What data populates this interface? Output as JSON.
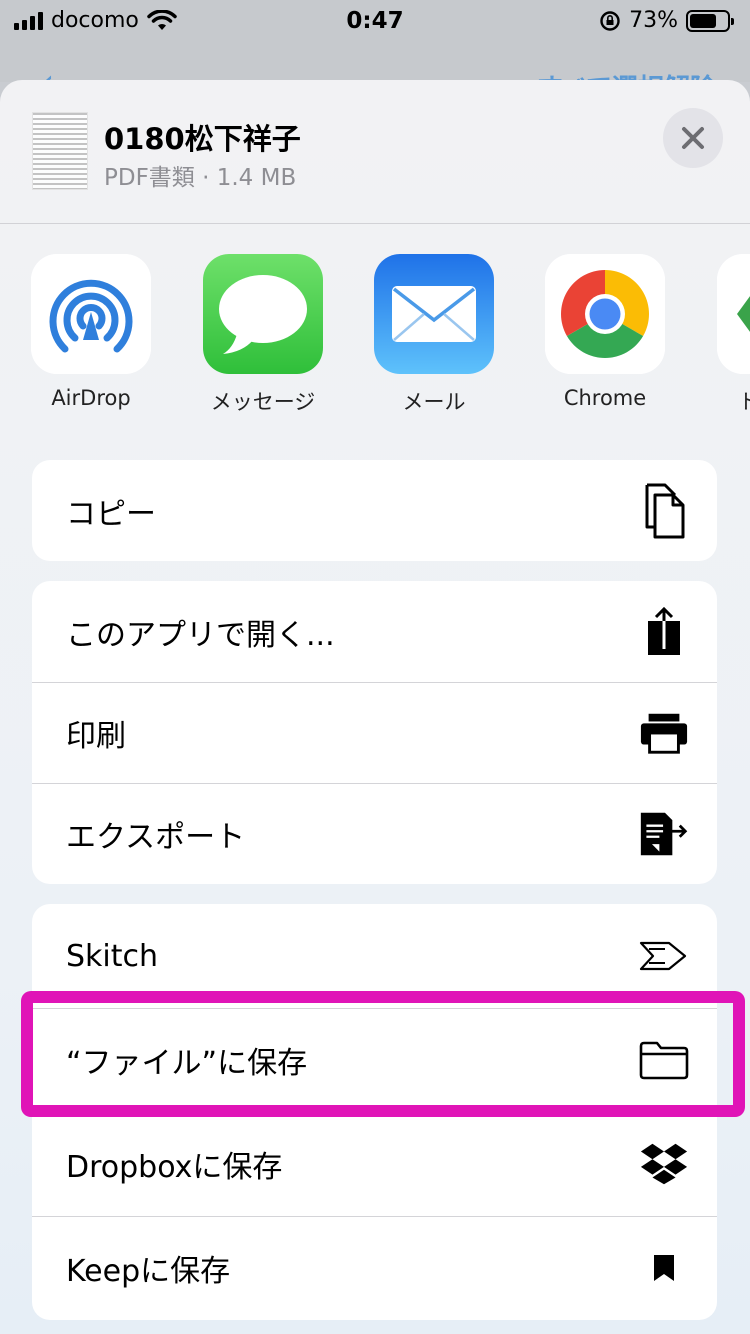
{
  "status_bar": {
    "carrier": "docomo",
    "time": "0:47",
    "battery": "73%",
    "battery_level": 0.73
  },
  "background": {
    "right_text": "すべて選択解除"
  },
  "share_sheet": {
    "doc_title": "0180松下祥子",
    "doc_subtitle": "PDF書類 · 1.4 MB",
    "apps": [
      {
        "label": "AirDrop",
        "icon": "airdrop-icon"
      },
      {
        "label": "メッセージ",
        "icon": "messages-icon"
      },
      {
        "label": "メール",
        "icon": "mail-icon"
      },
      {
        "label": "Chrome",
        "icon": "chrome-icon"
      },
      {
        "label": "ト",
        "icon": "partial-app-icon"
      }
    ],
    "groups": [
      [
        {
          "label": "コピー",
          "icon": "copy-icon"
        }
      ],
      [
        {
          "label": "このアプリで開く...",
          "icon": "share-icon"
        },
        {
          "label": "印刷",
          "icon": "print-icon"
        },
        {
          "label": "エクスポート",
          "icon": "export-icon"
        }
      ],
      [
        {
          "label": "Skitch",
          "icon": "skitch-icon"
        },
        {
          "label": "“ファイル”に保存",
          "icon": "folder-icon"
        },
        {
          "label": "Dropboxに保存",
          "icon": "dropbox-icon"
        },
        {
          "label": "Keepに保存",
          "icon": "bookmark-icon"
        }
      ]
    ]
  },
  "colors": {
    "highlight": "#e014b7",
    "accent": "#2e86d8"
  }
}
